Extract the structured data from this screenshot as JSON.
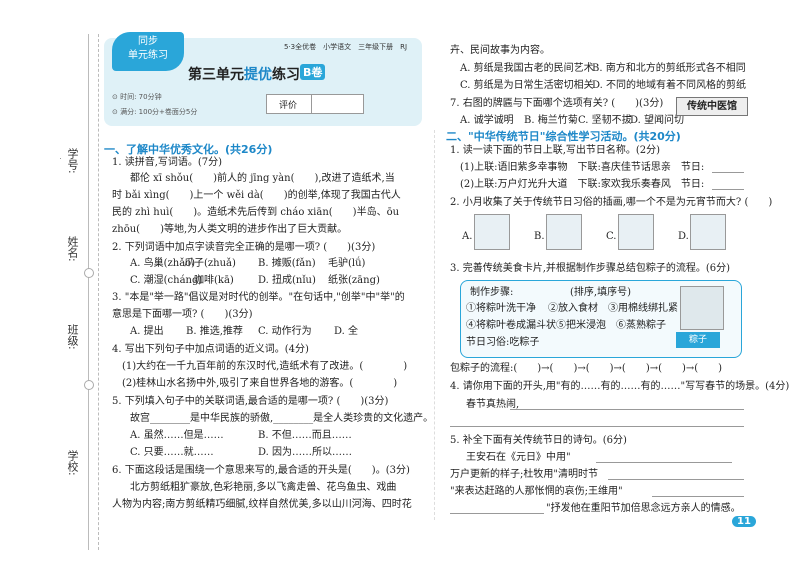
{
  "sidebar": {
    "school": "学校:",
    "class": "班级:",
    "name": "姓名:",
    "number": "学号:"
  },
  "header": {
    "badge_line1": "同步",
    "badge_line2": "单元练习",
    "book": "5·3全优卷　小学语文　三年级下册　RJ",
    "title_a": "第三单元",
    "title_b": "提优",
    "title_c": "练习",
    "title_mark": "B卷",
    "time": "时间: 70分钟",
    "score_info": "满分: 100分+卷面分5分",
    "score_label": "评价"
  },
  "section1": {
    "title": "一、了解中华优秀文化。(共26分)"
  },
  "q1": {
    "stem": "1. 读拼音,写词语。(7分)",
    "l1": "都伦 xī shǒu(　　)前人的 jīng yàn(　　),改进了造纸术,当",
    "l2": "时 bǎi xìng(　　)上一个 wěi dà(　　)的创举,体现了我国古代人",
    "l3": "民的 zhì huì(　　)。造纸术先后传到 cháo xiān(　　)半岛、ōu",
    "l4": "zhōu(　　)等地,为人类文明的进步作出了巨大贡献。"
  },
  "q2": {
    "stem": "2. 下列词语中加点字读音完全正确的是哪一项? (　　)(3分)",
    "a": "A. 鸟巢(zhǎo)",
    "a2": "爪子(zhuǎ)",
    "b": "B. 摊贩(fǎn)",
    "b2": "毛驴(lǘ)",
    "c": "C. 潮湿(cháng)",
    "c2": "咖啡(kā)",
    "d": "D. 扭成(nǐu)",
    "d2": "纸张(zāng)"
  },
  "q3": {
    "stem": "3. \"本是\"举一路\"倡议是对时代的创举。\"在句话中,\"创举\"中\"举\"的",
    "l2": "意思是下面哪一项? (　　)(3分)",
    "a": "A. 提出",
    "b": "B. 推选,推荐",
    "c": "C. 动作行为",
    "d": "D. 全"
  },
  "q4": {
    "stem": "4. 写出下列句子中加点词语的近义词。(4分)",
    "l1": "(1)大约在一千九百年前的东汉时代,造纸术有了改进。(　　　　)",
    "l2": "(2)桂林山水名扬中外,吸引了来自世界各地的游客。(　　　　)"
  },
  "q5": {
    "stem": "5. 下列填入句子中的关联词语,最合适的是哪一项? (　　)(3分)",
    "l1": "故宫________是中华民族的骄傲,________是全人类珍贵的文化遗产。",
    "a": "A. 虽然……但是……",
    "b": "B. 不但……而且……",
    "c": "C. 只要……就……",
    "d": "D. 因为……所以……"
  },
  "q6": {
    "stem": "6. 下面这段话是围绕一个意思来写的,最合适的开头是(　　)。(3分)",
    "l1": "北方剪纸粗犷豪放,色彩艳丽,多以飞禽走兽、花鸟鱼虫、戏曲",
    "l2": "人物为内容;南方剪纸精巧细腻,纹样自然优美,多以山川河海、四时花",
    "l3": "卉、民间故事为内容。",
    "a": "A. 剪纸是我国古老的民间艺术",
    "b": "B. 南方和北方的剪纸形式各不相同",
    "c": "C. 剪纸是为日常生活密切相关",
    "d": "D. 不同的地域有着不同风格的剪纸"
  },
  "q7": {
    "stem": "7. 右图的牌匾与下面哪个选项有关? (　　)(3分)",
    "a": "A. 诚学诚明",
    "b": "B. 梅兰竹菊",
    "c": "C. 坚韧不拔",
    "d": "D. 望闻问切",
    "stamp": "传统中医馆"
  },
  "section2": {
    "title": "二、\"中华传统节日\"综合性学习活动。(共20分)"
  },
  "q8": {
    "stem": "1. 读一读下面的节日上联,写出节日名称。(2分)",
    "l1": "(1)上联:语旧紫多幸事物　下联:喜庆佳节话思亲　节日:",
    "l2": "(2)上联:万户灯光升大道　下联:家欢我乐奏春风　节日:"
  },
  "q9": {
    "stem": "2. 小月收集了关于传统节日习俗的插画,哪一个不是为元宵节而大? (　　)",
    "a": "A.",
    "b": "B.",
    "c": "C.",
    "d": "D."
  },
  "q10": {
    "stem": "3. 完善传统美食卡片,并根据制作步骤总结包粽子的流程。(6分)",
    "steps_title": "制作步骤:",
    "steps_note": "(排序,填序号)",
    "s1": "①将粽叶洗干净",
    "s2": "②放入食材",
    "s3": "③用棉线绑扎紧",
    "s4": "④将粽叶卷成漏斗状",
    "s5": "⑤把米浸泡",
    "s6": "⑥蒸熟粽子",
    "flow_label": "节日习俗:吃粽子",
    "zz": "粽子",
    "flow": "包粽子的流程:(　　)→(　　)→(　　)→(　　)→(　　)→(　　)"
  },
  "q11": {
    "stem": "4. 请你用下面的开头,用\"有的……有的……有的……\"写写春节的场景。(4分)",
    "l1": "春节真热闹,"
  },
  "q12": {
    "stem": "5. 补全下面有关传统节日的诗句。(6分)",
    "l1": "王安石在《元日》中用\"",
    "l2": "万户更新的样子;杜牧用\"清明时节",
    "l3": "\"来表达赶路的人那怅惘的哀伤;王维用\"",
    "l4": "\"抒发他在重阳节加倍思念远方亲人的情感。"
  },
  "footer": {
    "page": "11"
  }
}
